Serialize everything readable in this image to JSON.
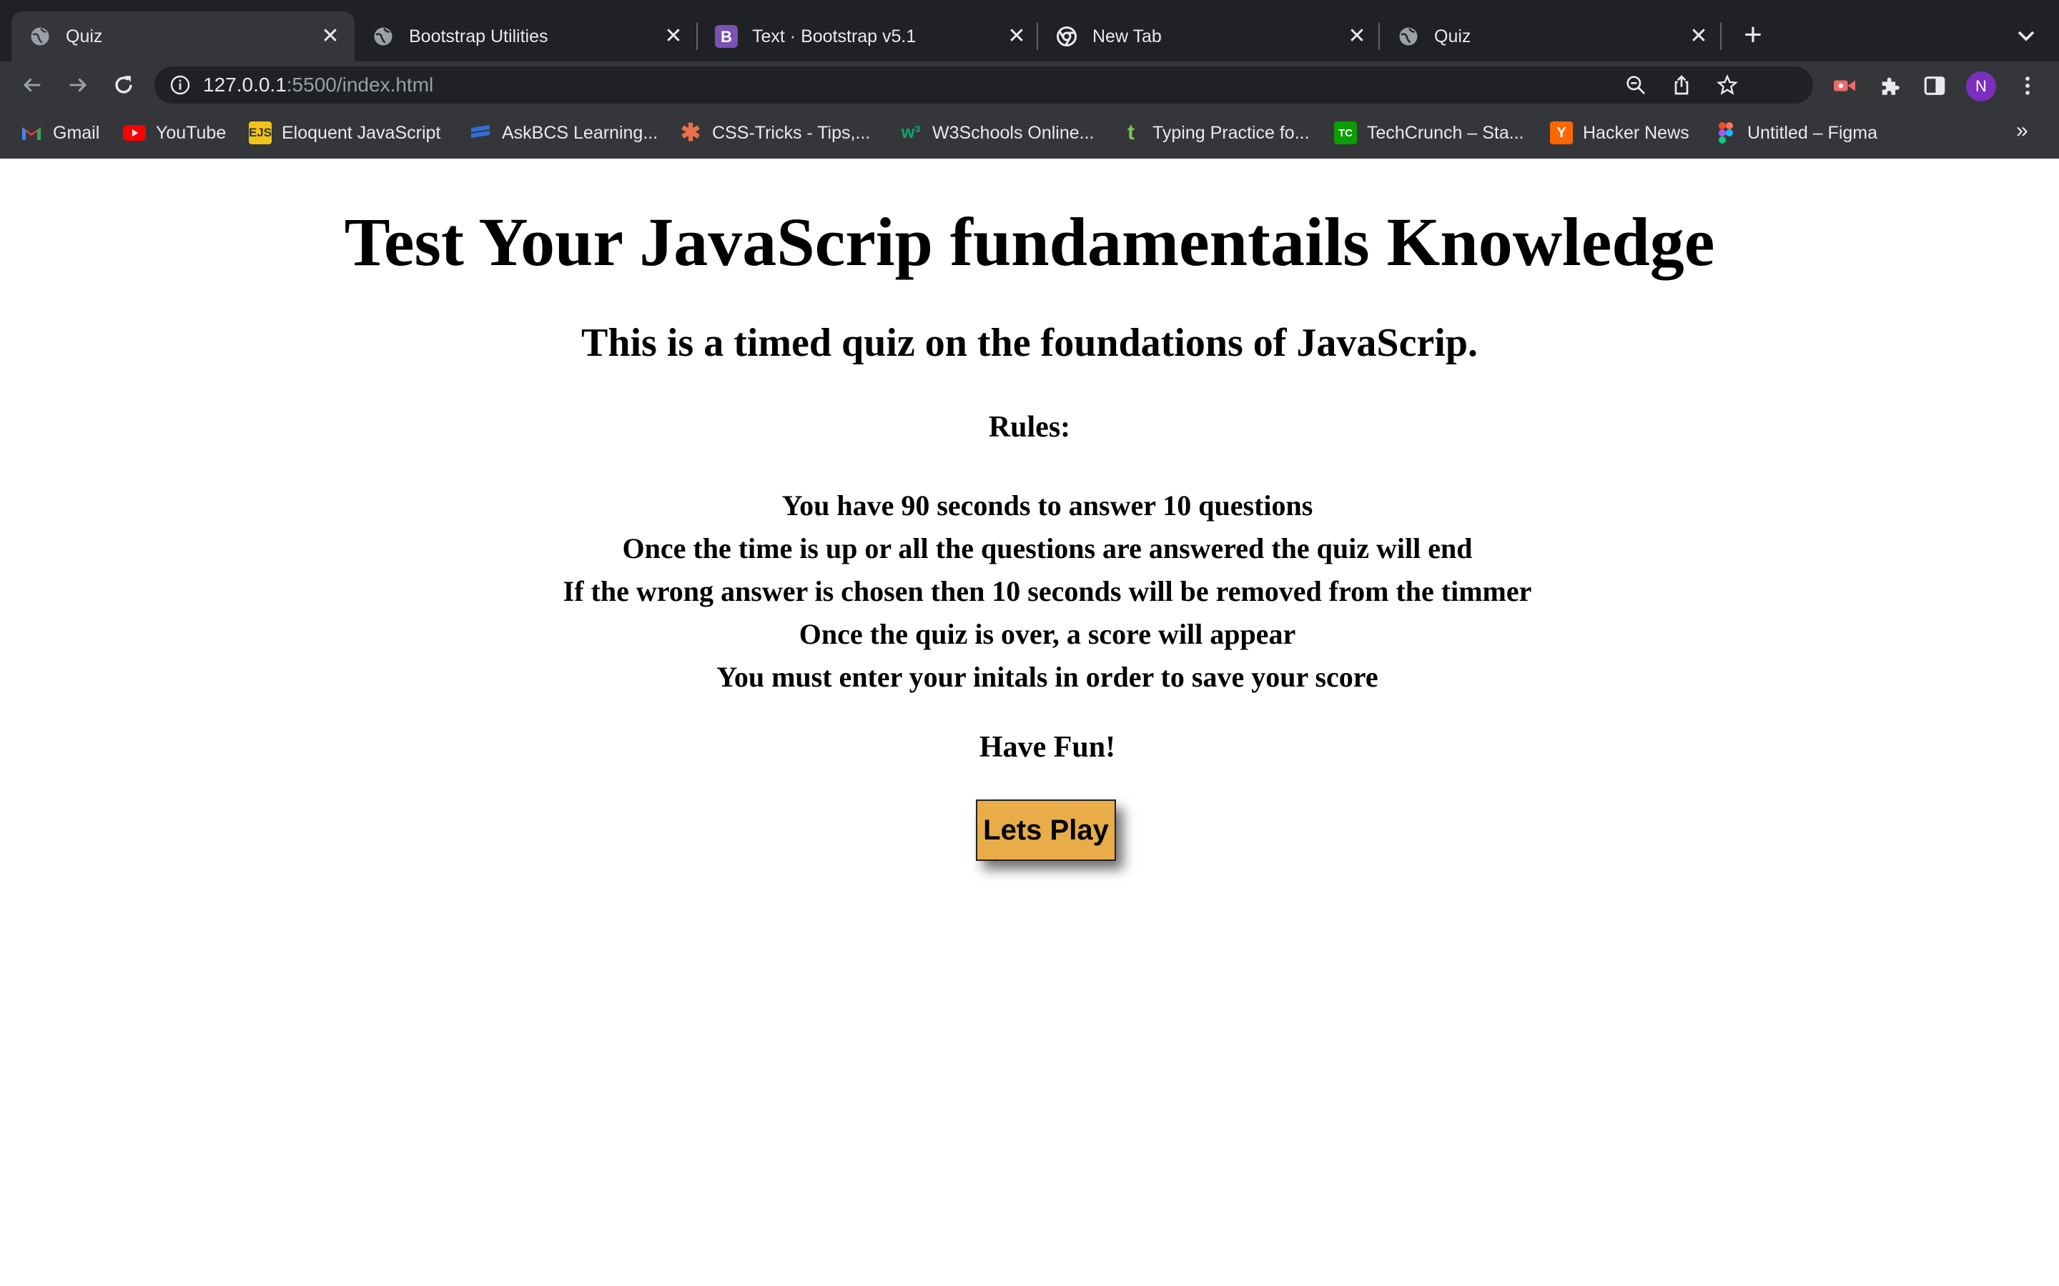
{
  "browser": {
    "tabs": [
      {
        "title": "Quiz",
        "favicon": "globe-icon",
        "active": true
      },
      {
        "title": "Bootstrap Utilities",
        "favicon": "globe-icon",
        "active": false
      },
      {
        "title": "Text · Bootstrap v5.1",
        "favicon": "bootstrap-icon",
        "active": false
      },
      {
        "title": "New Tab",
        "favicon": "chrome-icon",
        "active": false
      },
      {
        "title": "Quiz",
        "favicon": "globe-icon",
        "active": false
      }
    ],
    "url_host": "127.0.0.1",
    "url_rest": ":5500/index.html",
    "profile_initial": "N",
    "bookmarks": [
      {
        "label": "Gmail",
        "icon": "gmail-icon",
        "color": "#ea4335"
      },
      {
        "label": "YouTube",
        "icon": "youtube-icon",
        "color": "#ff0000"
      },
      {
        "label": "Eloquent JavaScript",
        "icon": "ejs-icon",
        "color": "#f0c419"
      },
      {
        "label": "AskBCS Learning...",
        "icon": "askbcs-icon",
        "color": "#2f6fd6"
      },
      {
        "label": "CSS-Tricks - Tips,...",
        "icon": "css-tricks-icon",
        "color": "#e8704a"
      },
      {
        "label": "W3Schools Online...",
        "icon": "w3schools-icon",
        "color": "#04aa6d"
      },
      {
        "label": "Typing Practice fo...",
        "icon": "typing-icon",
        "color": "#7ac943"
      },
      {
        "label": "TechCrunch – Sta...",
        "icon": "techcrunch-icon",
        "color": "#0a9e01"
      },
      {
        "label": "Hacker News",
        "icon": "hacker-news-icon",
        "color": "#ff6600"
      },
      {
        "label": "Untitled – Figma",
        "icon": "figma-icon",
        "color": "#a259ff"
      }
    ]
  },
  "quiz": {
    "heading": "Test Your JavaScrip fundamentails Knowledge",
    "subheading": "This is a timed quiz on the foundations of JavaScrip.",
    "rules_title": "Rules:",
    "rules": [
      "You have 90 seconds to answer 10 questions",
      "Once the time is up or all the questions are answered the quiz will end",
      "If the wrong answer is chosen then 10 seconds will be removed from the timmer",
      "Once the quiz is over, a score will appear",
      "You must enter your initals in order to save your score"
    ],
    "closing": "Have Fun!",
    "start_button": "Lets Play"
  }
}
